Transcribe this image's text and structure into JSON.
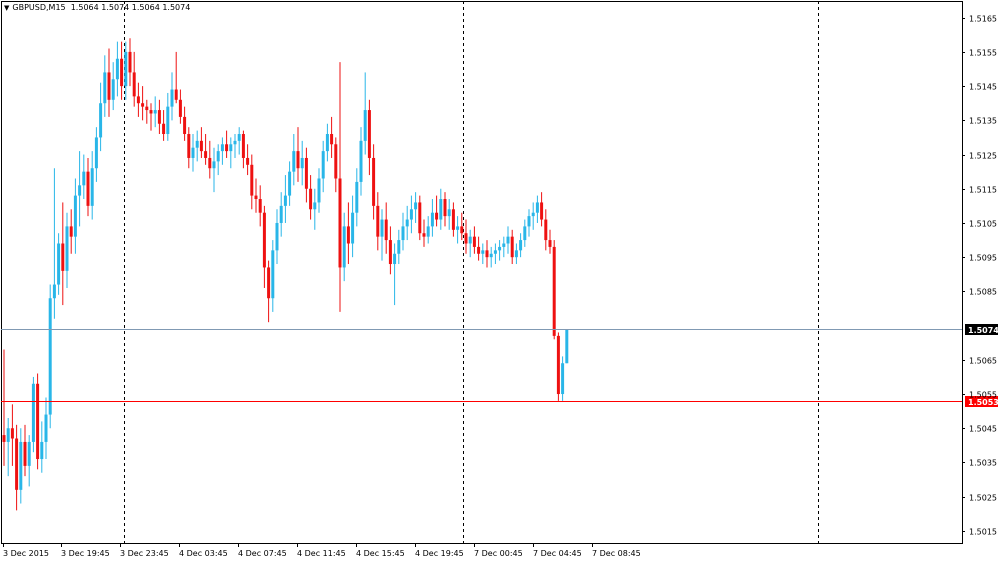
{
  "header": {
    "menu_glyph": "▼",
    "symbol": "GBPUSD,M15",
    "ohlc": "1.5064 1.5074 1.5064 1.5074"
  },
  "colors": {
    "bull": "#29b6e8",
    "bear": "#ee1111",
    "doji": "#000000",
    "bid_line": "#8099b3",
    "ask_line": "#ff0000",
    "bid_label_bg": "#000000",
    "ask_label_bg": "#ff0000",
    "frame": "#000000",
    "separator": "#000000"
  },
  "chart_data": {
    "type": "candlestick",
    "symbol": "GBPUSD",
    "timeframe": "M15",
    "price_range": [
      1.501,
      1.5169
    ],
    "y_ticks": [
      "1.5165",
      "1.5155",
      "1.5145",
      "1.5135",
      "1.5125",
      "1.5115",
      "1.5105",
      "1.5095",
      "1.5085",
      "1.5065",
      "1.5055",
      "1.5045",
      "1.5035",
      "1.5025",
      "1.5015"
    ],
    "x_ticks": [
      "3 Dec 2015",
      "3 Dec 19:45",
      "3 Dec 23:45",
      "4 Dec 03:45",
      "4 Dec 07:45",
      "4 Dec 11:45",
      "4 Dec 15:45",
      "4 Dec 19:45",
      "7 Dec 00:45",
      "7 Dec 04:45",
      "7 Dec 08:45"
    ],
    "price_lines": [
      {
        "label": "1.5074",
        "value": 1.5074,
        "kind": "bid"
      },
      {
        "label": "1.5053",
        "value": 1.5053,
        "kind": "ask"
      }
    ],
    "period_separators": [
      "3 Dec 23:45",
      "4 Dec 19:45",
      "7 Dec 12:45"
    ],
    "candles": [
      [
        1.5043,
        1.5068,
        1.5034,
        1.5041
      ],
      [
        1.5041,
        1.5048,
        1.5031,
        1.5045
      ],
      [
        1.5045,
        1.5052,
        1.5034,
        1.5042
      ],
      [
        1.5042,
        1.5046,
        1.5021,
        1.5027
      ],
      [
        1.5027,
        1.5045,
        1.5023,
        1.5041
      ],
      [
        1.5041,
        1.5046,
        1.5031,
        1.5034
      ],
      [
        1.5034,
        1.5043,
        1.5028,
        1.5041
      ],
      [
        1.5041,
        1.506,
        1.5038,
        1.5058
      ],
      [
        1.5058,
        1.5061,
        1.5033,
        1.5036
      ],
      [
        1.5036,
        1.5047,
        1.5032,
        1.5041
      ],
      [
        1.5041,
        1.5054,
        1.5036,
        1.5049
      ],
      [
        1.5049,
        1.5087,
        1.5045,
        1.5083
      ],
      [
        1.5083,
        1.5121,
        1.5077,
        1.5087
      ],
      [
        1.5087,
        1.5102,
        1.5084,
        1.5099
      ],
      [
        1.5099,
        1.5111,
        1.5081,
        1.5091
      ],
      [
        1.5091,
        1.5108,
        1.5086,
        1.5104
      ],
      [
        1.5104,
        1.5109,
        1.5096,
        1.5101
      ],
      [
        1.5101,
        1.5118,
        1.5096,
        1.5113
      ],
      [
        1.5113,
        1.5126,
        1.5104,
        1.5116
      ],
      [
        1.5116,
        1.5125,
        1.5112,
        1.512
      ],
      [
        1.512,
        1.5124,
        1.5107,
        1.511
      ],
      [
        1.511,
        1.5126,
        1.5106,
        1.5121
      ],
      [
        1.5121,
        1.5133,
        1.5117,
        1.513
      ],
      [
        1.513,
        1.5146,
        1.5126,
        1.514
      ],
      [
        1.514,
        1.5154,
        1.5136,
        1.5149
      ],
      [
        1.5149,
        1.5156,
        1.5136,
        1.5141
      ],
      [
        1.5141,
        1.5152,
        1.5138,
        1.5147
      ],
      [
        1.5147,
        1.5158,
        1.5142,
        1.5153
      ],
      [
        1.5153,
        1.5158,
        1.5141,
        1.5145
      ],
      [
        1.5145,
        1.5158,
        1.5141,
        1.5155
      ],
      [
        1.5155,
        1.5159,
        1.5145,
        1.5149
      ],
      [
        1.5149,
        1.5155,
        1.5139,
        1.5142
      ],
      [
        1.5142,
        1.5146,
        1.5136,
        1.514
      ],
      [
        1.514,
        1.5145,
        1.5135,
        1.5139
      ],
      [
        1.5139,
        1.5141,
        1.5134,
        1.5138
      ],
      [
        1.5138,
        1.514,
        1.5132,
        1.5137
      ],
      [
        1.5137,
        1.5142,
        1.5133,
        1.5138
      ],
      [
        1.5138,
        1.5141,
        1.5131,
        1.5134
      ],
      [
        1.5134,
        1.5138,
        1.5129,
        1.5131
      ],
      [
        1.5131,
        1.5143,
        1.5129,
        1.5139
      ],
      [
        1.5139,
        1.5149,
        1.5135,
        1.5144
      ],
      [
        1.5144,
        1.5155,
        1.514,
        1.5141
      ],
      [
        1.5141,
        1.5144,
        1.5134,
        1.5136
      ],
      [
        1.5136,
        1.5139,
        1.5129,
        1.5131
      ],
      [
        1.5131,
        1.5133,
        1.5121,
        1.5124
      ],
      [
        1.5124,
        1.5131,
        1.512,
        1.5127
      ],
      [
        1.5127,
        1.5132,
        1.5123,
        1.5129
      ],
      [
        1.5129,
        1.5133,
        1.5124,
        1.5126
      ],
      [
        1.5126,
        1.5131,
        1.5122,
        1.5124
      ],
      [
        1.5124,
        1.5129,
        1.5118,
        1.5121
      ],
      [
        1.5121,
        1.5127,
        1.5114,
        1.5123
      ],
      [
        1.5123,
        1.5128,
        1.5119,
        1.5126
      ],
      [
        1.5126,
        1.513,
        1.5122,
        1.5128
      ],
      [
        1.5128,
        1.5132,
        1.5124,
        1.5126
      ],
      [
        1.5126,
        1.513,
        1.5121,
        1.5128
      ],
      [
        1.5128,
        1.5131,
        1.5124,
        1.5129
      ],
      [
        1.5129,
        1.5133,
        1.5125,
        1.5131
      ],
      [
        1.5131,
        1.5132,
        1.5121,
        1.5124
      ],
      [
        1.5124,
        1.5128,
        1.5119,
        1.5122
      ],
      [
        1.5122,
        1.5125,
        1.5109,
        1.5113
      ],
      [
        1.5113,
        1.5118,
        1.5108,
        1.5112
      ],
      [
        1.5112,
        1.5116,
        1.5104,
        1.5108
      ],
      [
        1.5108,
        1.511,
        1.5086,
        1.5092
      ],
      [
        1.5092,
        1.5094,
        1.5076,
        1.5083
      ],
      [
        1.5083,
        1.51,
        1.5079,
        1.5097
      ],
      [
        1.5097,
        1.5109,
        1.5093,
        1.5105
      ],
      [
        1.5105,
        1.5114,
        1.5101,
        1.511
      ],
      [
        1.511,
        1.5119,
        1.5105,
        1.5113
      ],
      [
        1.5113,
        1.5123,
        1.511,
        1.512
      ],
      [
        1.512,
        1.5131,
        1.5116,
        1.5126
      ],
      [
        1.5126,
        1.5133,
        1.5117,
        1.5121
      ],
      [
        1.5121,
        1.5129,
        1.5116,
        1.5124
      ],
      [
        1.5124,
        1.5127,
        1.5111,
        1.5115
      ],
      [
        1.5115,
        1.5119,
        1.5106,
        1.5109
      ],
      [
        1.5109,
        1.5115,
        1.5103,
        1.5111
      ],
      [
        1.5111,
        1.5121,
        1.5108,
        1.5118
      ],
      [
        1.5118,
        1.5129,
        1.5114,
        1.5126
      ],
      [
        1.5126,
        1.5134,
        1.5123,
        1.5131
      ],
      [
        1.5131,
        1.5136,
        1.5124,
        1.5128
      ],
      [
        1.5128,
        1.513,
        1.5114,
        1.5118
      ],
      [
        1.5118,
        1.5152,
        1.5079,
        1.5092
      ],
      [
        1.5092,
        1.5108,
        1.5088,
        1.5104
      ],
      [
        1.5104,
        1.5111,
        1.5093,
        1.5099
      ],
      [
        1.5099,
        1.5113,
        1.5095,
        1.5108
      ],
      [
        1.5108,
        1.5121,
        1.5104,
        1.5117
      ],
      [
        1.5117,
        1.5133,
        1.5113,
        1.5129
      ],
      [
        1.5129,
        1.5149,
        1.5125,
        1.5138
      ],
      [
        1.5138,
        1.5141,
        1.5119,
        1.5124
      ],
      [
        1.5124,
        1.5128,
        1.5106,
        1.511
      ],
      [
        1.511,
        1.5114,
        1.5097,
        1.5101
      ],
      [
        1.5101,
        1.5109,
        1.5094,
        1.5106
      ],
      [
        1.5106,
        1.5111,
        1.5096,
        1.51
      ],
      [
        1.51,
        1.5104,
        1.509,
        1.5093
      ],
      [
        1.5093,
        1.5099,
        1.5081,
        1.5096
      ],
      [
        1.5096,
        1.5103,
        1.5093,
        1.51
      ],
      [
        1.51,
        1.5108,
        1.5097,
        1.5104
      ],
      [
        1.5104,
        1.511,
        1.51,
        1.5106
      ],
      [
        1.5106,
        1.5113,
        1.5102,
        1.5109
      ],
      [
        1.5109,
        1.5114,
        1.5105,
        1.5111
      ],
      [
        1.5111,
        1.5113,
        1.51,
        1.5102
      ],
      [
        1.5102,
        1.5106,
        1.5098,
        1.5101
      ],
      [
        1.5101,
        1.5107,
        1.5099,
        1.5104
      ],
      [
        1.5104,
        1.5112,
        1.5101,
        1.5108
      ],
      [
        1.5108,
        1.5113,
        1.5104,
        1.5106
      ],
      [
        1.5106,
        1.5115,
        1.5103,
        1.5112
      ],
      [
        1.5112,
        1.5114,
        1.5104,
        1.5107
      ],
      [
        1.5107,
        1.5112,
        1.5103,
        1.5109
      ],
      [
        1.5109,
        1.5111,
        1.5101,
        1.5103
      ],
      [
        1.5103,
        1.5107,
        1.5099,
        1.5104
      ],
      [
        1.5104,
        1.5108,
        1.51,
        1.5102
      ],
      [
        1.5102,
        1.5106,
        1.5096,
        1.5099
      ],
      [
        1.5099,
        1.5103,
        1.5095,
        1.5101
      ],
      [
        1.5101,
        1.5104,
        1.5096,
        1.5098
      ],
      [
        1.5098,
        1.5101,
        1.5094,
        1.5096
      ],
      [
        1.5096,
        1.5099,
        1.5093,
        1.5097
      ],
      [
        1.5097,
        1.51,
        1.5092,
        1.5095
      ],
      [
        1.5095,
        1.5098,
        1.5092,
        1.5096
      ],
      [
        1.5096,
        1.5099,
        1.5093,
        1.5097
      ],
      [
        1.5097,
        1.51,
        1.5094,
        1.5098
      ],
      [
        1.5098,
        1.5101,
        1.5095,
        1.5099
      ],
      [
        1.5099,
        1.5104,
        1.5096,
        1.5101
      ],
      [
        1.5101,
        1.5103,
        1.5093,
        1.5095
      ],
      [
        1.5095,
        1.5099,
        1.5093,
        1.5097
      ],
      [
        1.5097,
        1.5102,
        1.5095,
        1.51
      ],
      [
        1.51,
        1.5106,
        1.5098,
        1.5104
      ],
      [
        1.5104,
        1.5109,
        1.5101,
        1.5107
      ],
      [
        1.5107,
        1.5111,
        1.5103,
        1.5108
      ],
      [
        1.5108,
        1.5113,
        1.5105,
        1.5111
      ],
      [
        1.5111,
        1.5114,
        1.5104,
        1.5106
      ],
      [
        1.5106,
        1.5109,
        1.5097,
        1.51
      ],
      [
        1.51,
        1.5103,
        1.5096,
        1.5098
      ],
      [
        1.5098,
        1.51,
        1.5071,
        1.5072
      ],
      [
        1.5072,
        1.5073,
        1.5053,
        1.5055
      ],
      [
        1.5055,
        1.5066,
        1.5053,
        1.5064
      ],
      [
        1.5064,
        1.5074,
        1.5064,
        1.5074
      ]
    ]
  }
}
